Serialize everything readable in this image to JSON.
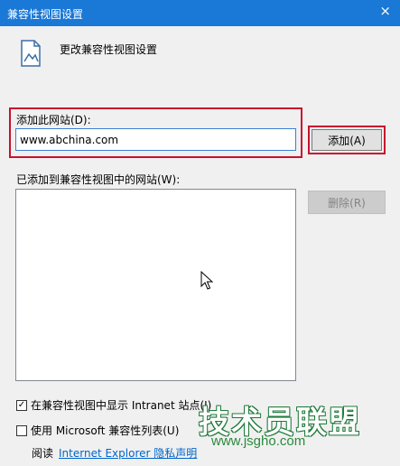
{
  "window": {
    "title": "兼容性视图设置",
    "close_symbol": "×"
  },
  "header": {
    "text": "更改兼容性视图设置",
    "icon": "compatibility-page-icon"
  },
  "add_section": {
    "label": "添加此网站(D):",
    "input_value": "www.abchina.com",
    "add_button_label": "添加(A)"
  },
  "list_section": {
    "label": "已添加到兼容性视图中的网站(W):",
    "items": [],
    "delete_button_label": "删除(R)"
  },
  "options": {
    "intranet": {
      "label": "在兼容性视图中显示 Intranet 站点(I)",
      "checked": true,
      "mark": "✓"
    },
    "ms_list": {
      "label": "使用 Microsoft 兼容性列表(U)",
      "checked": false
    }
  },
  "footer": {
    "prefix": "阅读",
    "link_text": "Internet Explorer 隐私声明"
  },
  "watermark": {
    "main": "技术员联盟",
    "url": "www.jsgho.com"
  },
  "colors": {
    "titlebar": "#1a78d6",
    "highlight_border": "#c8102e",
    "link": "#0066cc"
  }
}
